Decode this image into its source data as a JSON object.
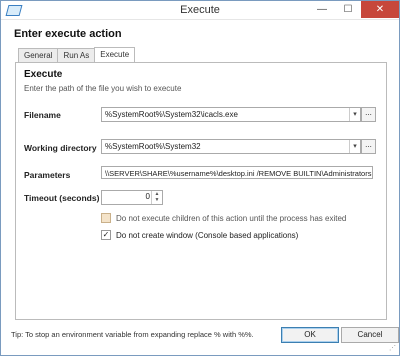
{
  "window": {
    "title": "Execute",
    "minimize": "—",
    "maximize": "☐",
    "close": "✕"
  },
  "header": {
    "title": "Enter execute action"
  },
  "tabs": [
    {
      "label": "General"
    },
    {
      "label": "Run As"
    },
    {
      "label": "Execute"
    }
  ],
  "section": {
    "title": "Execute",
    "subtitle": "Enter the path of the file you wish to execute"
  },
  "filename": {
    "label": "Filename",
    "value": "%SystemRoot%\\System32\\icacls.exe"
  },
  "working_directory": {
    "label": "Working directory",
    "value": "%SystemRoot%\\System32"
  },
  "parameters": {
    "label": "Parameters",
    "value": "\\\\SERVER\\SHARE\\%username%\\desktop.ini /REMOVE BUILTIN\\Administrators"
  },
  "timeout": {
    "label": "Timeout (seconds)",
    "value": "0"
  },
  "options": {
    "no_exec_children": {
      "label": "Do not execute children of this action until the process has exited",
      "checked": false
    },
    "no_window": {
      "label": "Do not create window (Console based applications)",
      "checked": true
    }
  },
  "footer": {
    "tip": "Tip: To stop an environment variable from expanding replace % with %%.",
    "ok_label": "OK",
    "cancel_label": "Cancel"
  },
  "glyphs": {
    "dropdown": "▾",
    "browse": "...",
    "spin_up": "▲",
    "spin_down": "▼",
    "check": "✓"
  }
}
